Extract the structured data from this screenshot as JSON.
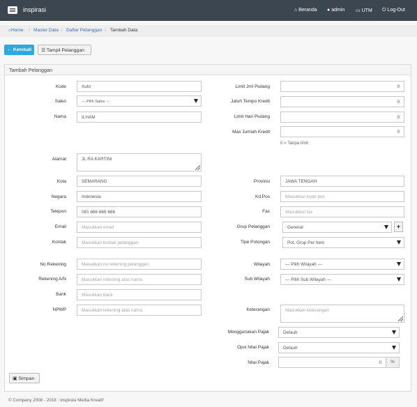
{
  "app": {
    "brand": "inspirasi"
  },
  "navbar": {
    "beranda": "Beranda",
    "admin": "admin",
    "utm": "UTM",
    "logout": "Log-Out"
  },
  "breadcrumb": {
    "home": "Home",
    "master": "Master Data",
    "daftar": "Daftar Pelanggan",
    "current": "Tambah Data"
  },
  "toolbar": {
    "kembali": "Kembali",
    "tampil": "Tampil Pelanggan"
  },
  "panel": {
    "title": "Tambah Pelanggan"
  },
  "left": {
    "kode": {
      "label": "Kode",
      "value": "Auto"
    },
    "sales": {
      "label": "Sales",
      "value": "--- Pilih Sales ---"
    },
    "nama": {
      "label": "Nama",
      "value": "ILHAM"
    },
    "alamat": {
      "label": "Alamat",
      "value": "JL RA KARTINI"
    },
    "kota": {
      "label": "Kota",
      "value": "SEMARANG"
    },
    "negara": {
      "label": "Negara",
      "value": "Indonesia"
    },
    "telepon": {
      "label": "Telepon",
      "value": "081 666 666 666"
    },
    "email": {
      "label": "Email",
      "placeholder": "Masukkan email"
    },
    "kontak": {
      "label": "Kontak",
      "placeholder": "Masukkan kontak pelanggan"
    },
    "norek": {
      "label": "No Rekening",
      "placeholder": "Masukkan no rekening pelanggan"
    },
    "rekan": {
      "label": "Rekening A/N",
      "placeholder": "Masukkan rekening atas nama"
    },
    "bank": {
      "label": "Bank",
      "placeholder": "Masukkan bank"
    },
    "npwp": {
      "label": "NPWP",
      "placeholder": "Masukkan rekening atas nama"
    }
  },
  "right": {
    "limit_piutang": {
      "label": "Limit Jml Piutang",
      "value": "0"
    },
    "jatuh_tempo": {
      "label": "Jatuh Tempo Kredit",
      "value": "0"
    },
    "limit_hari": {
      "label": "Limit Hari Piutang",
      "value": "0"
    },
    "max_kredit": {
      "label": "Max Jumlah Kredit",
      "value": "0"
    },
    "hint": "0 = Tanpa limit",
    "provinsi": {
      "label": "Provinsi",
      "value": "JAWA TENGAH"
    },
    "kdpos": {
      "label": "Kd.Pos",
      "placeholder": "Masukkan kode pos"
    },
    "fax": {
      "label": "Fax",
      "placeholder": "Masukkan fax"
    },
    "grup": {
      "label": "Grup Pelanggan",
      "value": "General"
    },
    "tipe": {
      "label": "Tipe Potongan",
      "value": "Pot. Grup Per Item"
    },
    "wilayah": {
      "label": "Wilayah",
      "value": "--- Pilih Wilayah ---"
    },
    "subwilayah": {
      "label": "Sub Wilayah",
      "value": "--- Pilih Sub Wilayah ---"
    },
    "keterangan": {
      "label": "Keterangan",
      "placeholder": "Masukkan keterangan"
    },
    "pajak": {
      "label": "Menggunakan Pajak",
      "value": "Default"
    },
    "opsi_pajak": {
      "label": "Opsi Nilai Pajak",
      "value": "Default"
    },
    "nilai_pajak": {
      "label": "Nilai Pajak",
      "value": "0",
      "addon": "%"
    }
  },
  "actions": {
    "simpan": "Simpan"
  },
  "footer": {
    "text": "© Company 2008 - 2018 : Inspirasi Media Kreatif"
  }
}
